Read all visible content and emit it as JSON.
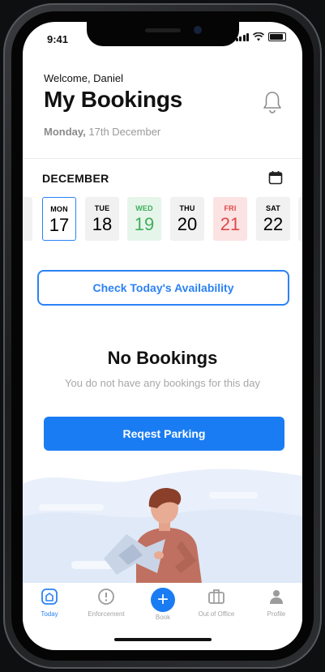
{
  "status": {
    "time": "9:41"
  },
  "header": {
    "welcome": "Welcome, Daniel",
    "title": "My Bookings",
    "date_day": "Monday,",
    "date_rest": " 17th December"
  },
  "calendar": {
    "month": "DECEMBER",
    "days": [
      {
        "name": "MON",
        "date": "17",
        "state": "selected"
      },
      {
        "name": "TUE",
        "date": "18",
        "state": "normal"
      },
      {
        "name": "WED",
        "date": "19",
        "state": "available"
      },
      {
        "name": "THU",
        "date": "20",
        "state": "normal"
      },
      {
        "name": "FRI",
        "date": "21",
        "state": "unavailable"
      },
      {
        "name": "SAT",
        "date": "22",
        "state": "normal"
      }
    ]
  },
  "main": {
    "check_button": "Check Today's Availability",
    "empty_title": "No Bookings",
    "empty_subtitle": "You do not have any bookings for this day",
    "request_button": "Reqest Parking"
  },
  "tabs": [
    {
      "label": "Today",
      "icon": "home-icon",
      "active": true
    },
    {
      "label": "Enforcement",
      "icon": "alert-circle-icon",
      "active": false
    },
    {
      "label": "Book",
      "icon": "plus-icon",
      "active": false
    },
    {
      "label": "Out of Office",
      "icon": "briefcase-icon",
      "active": false
    },
    {
      "label": "Profile",
      "icon": "user-icon",
      "active": false
    }
  ],
  "colors": {
    "accent": "#1a7cf2",
    "available": "#3fae5c",
    "unavailable": "#e04848"
  }
}
